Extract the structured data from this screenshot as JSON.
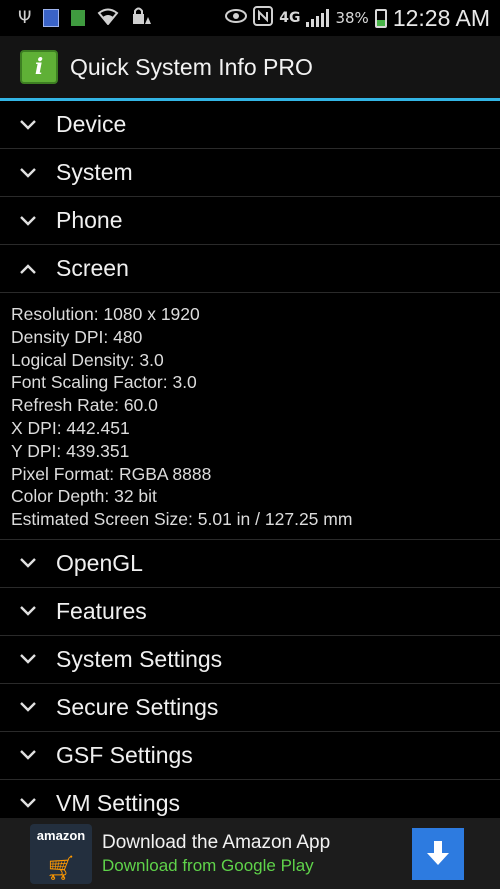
{
  "status_bar": {
    "icons": [
      "usb-icon",
      "notification-blue-icon",
      "notification-green-icon",
      "wifi-icon",
      "lock-alert-icon",
      "eye-icon",
      "nfc-icon"
    ],
    "network": "4G",
    "battery_percent": "38%",
    "time": "12:28 AM"
  },
  "app": {
    "icon_letter": "i",
    "title": "Quick System Info PRO",
    "accent_color": "#33b5e5"
  },
  "sections": [
    {
      "label": "Device",
      "expanded": false
    },
    {
      "label": "System",
      "expanded": false
    },
    {
      "label": "Phone",
      "expanded": false
    },
    {
      "label": "Screen",
      "expanded": true
    },
    {
      "label": "OpenGL",
      "expanded": false
    },
    {
      "label": "Features",
      "expanded": false
    },
    {
      "label": "System Settings",
      "expanded": false
    },
    {
      "label": "Secure Settings",
      "expanded": false
    },
    {
      "label": "GSF Settings",
      "expanded": false
    },
    {
      "label": "VM Settings",
      "expanded": false
    }
  ],
  "screen_details": [
    "Resolution: 1080 x 1920",
    "Density DPI: 480",
    "Logical Density: 3.0",
    "Font Scaling Factor: 3.0",
    "Refresh Rate: 60.0",
    "X DPI: 442.451",
    "Y DPI: 439.351",
    "Pixel Format: RGBA 8888",
    "Color Depth: 32 bit",
    "Estimated Screen Size: 5.01 in / 127.25 mm"
  ],
  "ad": {
    "logo_text": "amazon",
    "title": "Download the Amazon App",
    "subtitle": "Download from Google Play",
    "button_icon": "download-arrow-icon"
  }
}
